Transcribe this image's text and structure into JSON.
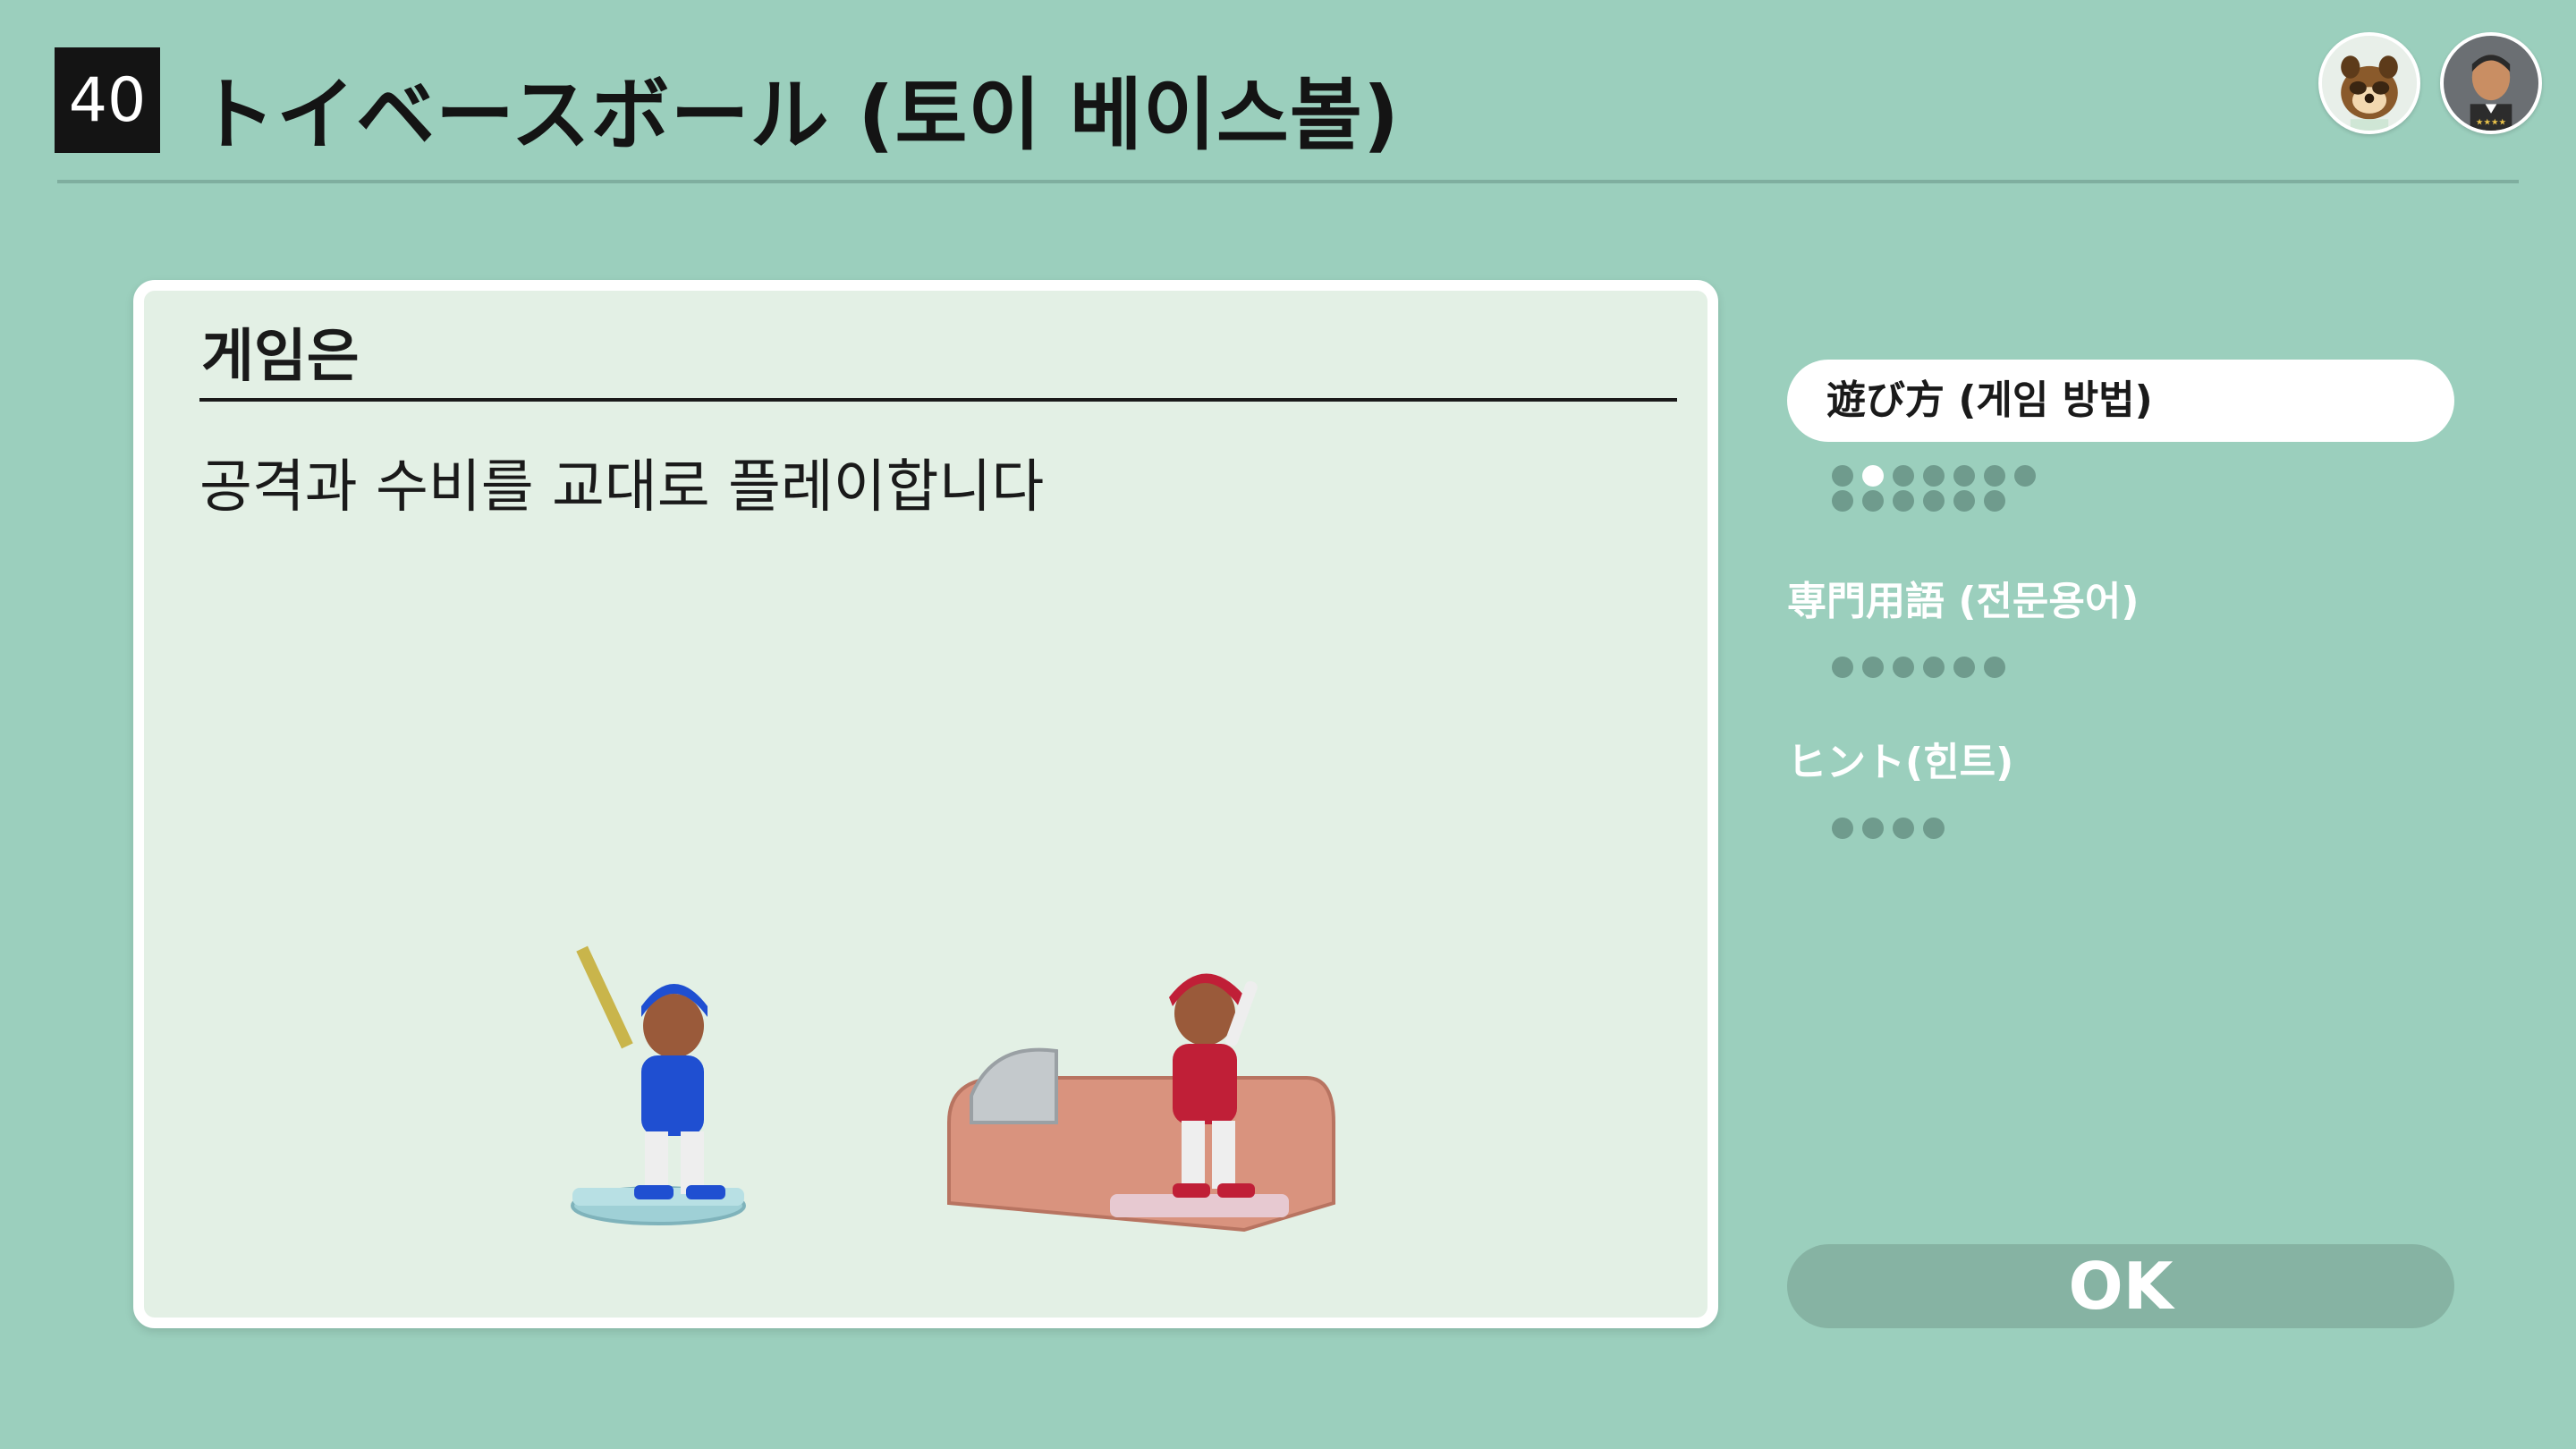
{
  "header": {
    "number": "40",
    "title": "トイベースボール (토이 베이스볼)"
  },
  "card": {
    "heading": "게임은",
    "body": "공격과 수비를 교대로 플레이합니다"
  },
  "sidebar": {
    "tabs": [
      {
        "label": "遊び方 (게임 방법)",
        "active": true,
        "total": 13,
        "current": 2
      },
      {
        "label": "専門用語 (전문용어)",
        "active": false,
        "total": 6,
        "current": 0
      },
      {
        "label": "ヒント(힌트)",
        "active": false,
        "total": 4,
        "current": 0
      }
    ],
    "ok_label": "OK"
  },
  "avatars": [
    {
      "icon": "tanuki-character-icon"
    },
    {
      "icon": "player-mii-icon"
    }
  ],
  "colors": {
    "background": "#9bcfbd",
    "card": "#e3f0e5",
    "ok_button": "#86b3a3",
    "batter_uniform": "#1f4fd1",
    "pitcher_uniform": "#c01f37"
  }
}
